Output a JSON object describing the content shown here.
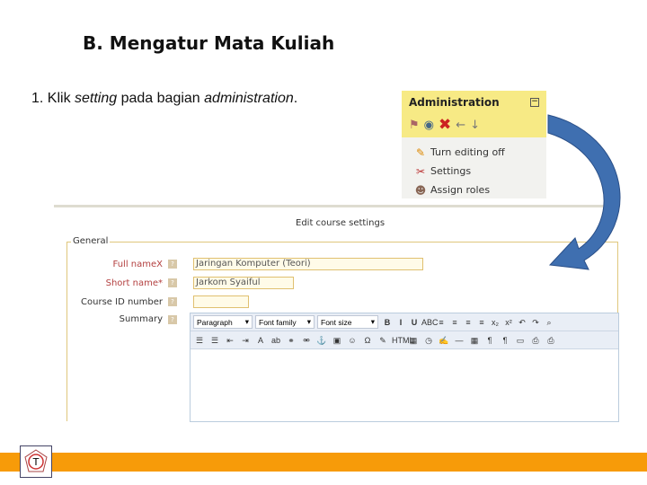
{
  "slide": {
    "title": "B.  Mengatur Mata Kuliah",
    "step_prefix": "1.  Klik ",
    "step_em1": "setting",
    "step_mid": " pada bagian ",
    "step_em2": "administration",
    "step_end": "."
  },
  "admin": {
    "title": "Administration",
    "collapse": "−",
    "icons": [
      "role-icon",
      "eye-icon",
      "delete-x-icon",
      "arrow-left-icon",
      "arrow-down-icon"
    ],
    "items": [
      {
        "label": "Turn editing off",
        "icon": "pencil-icon"
      },
      {
        "label": "Settings",
        "icon": "tools-icon"
      },
      {
        "label": "Assign roles",
        "icon": "users-icon"
      }
    ]
  },
  "course": {
    "title": "Edit course settings",
    "legend": "General",
    "fields": [
      {
        "label": "Full name",
        "required": "X",
        "value": "Jaringan Komputer (Teori)"
      },
      {
        "label": "Short name",
        "required": "*",
        "value": "Jarkom Syaiful"
      },
      {
        "label": "Course ID number",
        "value": ""
      },
      {
        "label": "Summary"
      }
    ],
    "help": "?",
    "editor": {
      "selects": [
        "Paragraph",
        "Font family",
        "Font size"
      ],
      "row1": [
        "B",
        "I",
        "U",
        "ABC",
        "≡",
        "≡",
        "≡",
        "≡",
        "x₂",
        "x²",
        "↶",
        "↷",
        "⌕"
      ],
      "row2": [
        "☰",
        "☰",
        "⇤",
        "⇥",
        "A",
        "ab",
        "⚭",
        "⚮",
        "⚓",
        "▣",
        "☺",
        "Ω",
        "✎",
        "HTML",
        "▦",
        "◷",
        "✍",
        "—",
        "▦",
        "¶",
        "¶",
        "▭",
        "⎙",
        "⎙"
      ]
    }
  },
  "colors": {
    "accent_bar": "#f79b09",
    "admin_header": "#f7ea85",
    "arrow": "#3f6fb0"
  }
}
